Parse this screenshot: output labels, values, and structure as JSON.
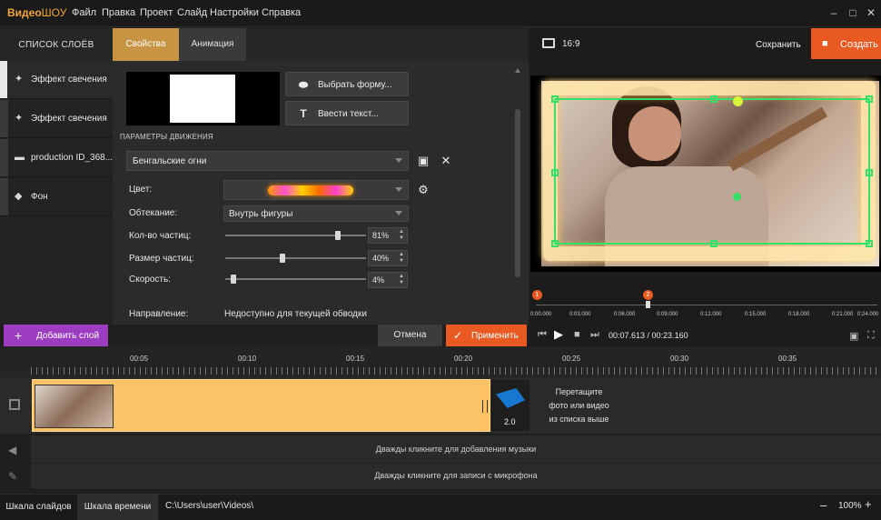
{
  "app": {
    "logo_part1": "Видео",
    "logo_part2": "ШОУ"
  },
  "menu": [
    "Файл",
    "Правка",
    "Проект",
    "Слайд",
    "Настройки",
    "Справка"
  ],
  "window_controls": [
    "–",
    "□",
    "✕"
  ],
  "layers": {
    "title": "СПИСОК СЛОЁВ",
    "items": [
      {
        "label": "Эффект свечения",
        "icon": "magic-wand-icon"
      },
      {
        "label": "Эффект свечения",
        "icon": "magic-wand-icon"
      },
      {
        "label": "production ID_368...",
        "icon": "film-clip-icon"
      },
      {
        "label": "Фон",
        "icon": "paint-bucket-icon"
      }
    ]
  },
  "tabs": {
    "properties": "Свойства",
    "animation": "Анимация"
  },
  "properties": {
    "choose_shape": "Выбрать форму...",
    "enter_text": "Ввести текст...",
    "section_title": "ПАРАМЕТРЫ ДВИЖЕНИЯ",
    "preset": "Бенгальские огни",
    "color_label": "Цвет:",
    "wrap_label": "Обтекание:",
    "wrap_value": "Внутрь фигуры",
    "count_label": "Кол-во частиц:",
    "count_value": "81%",
    "count_fraction": 0.81,
    "size_label": "Размер частиц:",
    "size_value": "40%",
    "size_fraction": 0.4,
    "speed_label": "Скорость:",
    "speed_value": "4%",
    "speed_fraction": 0.04,
    "direction_label": "Направление:",
    "direction_value": "Недоступно для текущей обводки"
  },
  "preview": {
    "ratio": "16:9",
    "save": "Сохранить",
    "create": "Создать",
    "markers": [
      "1",
      "2"
    ],
    "ticks": [
      "0:00.000",
      "0:03.000",
      "0:06.000",
      "0:09.000",
      "0:12.000",
      "0:15.000",
      "0:18.000",
      "0:21.000",
      "0:24.000"
    ]
  },
  "actions": {
    "add_layer": "Добавить слой",
    "cancel": "Отмена",
    "apply": "Применить",
    "timecode": "00:07.613 / 00:23.160"
  },
  "timeline": {
    "ruler": [
      "00:05",
      "00:10",
      "00:15",
      "00:20",
      "00:25",
      "00:30",
      "00:35"
    ],
    "transition_value": "2.0",
    "drop_hint_1": "Перетащите",
    "drop_hint_2": "фото или видео",
    "drop_hint_3": "из списка выше",
    "music_hint": "Дважды кликните для добавления музыки",
    "mic_hint": "Дважды кликните для записи с микрофона"
  },
  "bottom": {
    "slides": "Шкала слайдов",
    "timeline": "Шкала времени",
    "path": "C:\\Users\\user\\Videos\\",
    "zoom": "100%"
  },
  "colors": {
    "accent_orange": "#e85a22",
    "tab_gold": "#c79443",
    "add_purple": "#9b3cc1",
    "clip_yellow": "#fcc266",
    "selection_green": "#34e065"
  }
}
